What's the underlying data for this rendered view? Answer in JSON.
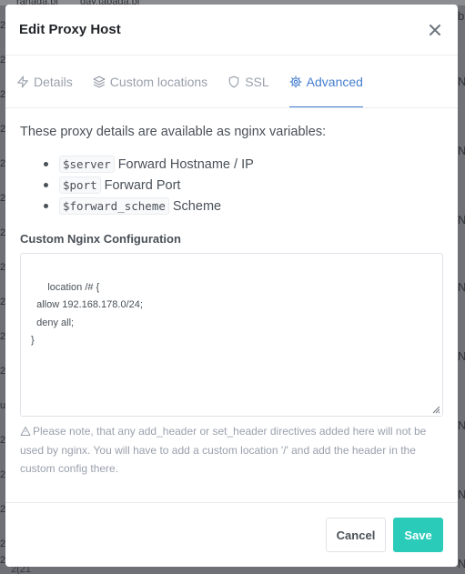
{
  "background": {
    "fragments": [
      "ranada.pl",
      "day.tapada.pl"
    ],
    "left_edge": [
      "2",
      "2",
      "2",
      "2",
      "2",
      "2",
      "2",
      "2",
      "2",
      "2",
      "2",
      "u",
      "2",
      "2",
      "2",
      "2",
      "2"
    ],
    "right_edge": [
      "b",
      "N",
      "N",
      "N",
      "N",
      "N",
      "N",
      "N",
      "N",
      "N",
      "N",
      "N",
      "N",
      "N",
      "N"
    ],
    "bottom_fragment": "2(21"
  },
  "modal": {
    "title": "Edit Proxy Host",
    "close_icon": "close-icon"
  },
  "tabs": [
    {
      "label": "Details",
      "icon": "lightning-icon",
      "active": false
    },
    {
      "label": "Custom locations",
      "icon": "layers-icon",
      "active": false
    },
    {
      "label": "SSL",
      "icon": "shield-icon",
      "active": false
    },
    {
      "label": "Advanced",
      "icon": "gear-icon",
      "active": true
    }
  ],
  "advanced": {
    "intro": "These proxy details are available as nginx variables:",
    "variables": [
      {
        "code": "$server",
        "desc": "Forward Hostname / IP"
      },
      {
        "code": "$port",
        "desc": "Forward Port"
      },
      {
        "code": "$forward_scheme",
        "desc": "Scheme"
      }
    ],
    "config_label": "Custom Nginx Configuration",
    "config_value": "location /# {\n  allow 192.168.178.0/24;\n  deny all;\n}",
    "note": "Please note, that any add_header or set_header directives added here will not be used by nginx. You will have to add a custom location '/' and add the header in the custom config there."
  },
  "footer": {
    "cancel_label": "Cancel",
    "save_label": "Save"
  },
  "colors": {
    "accent": "#467fcf",
    "save": "#2bcbba",
    "muted": "#9aa0ac",
    "overlay": "#6f7176"
  }
}
